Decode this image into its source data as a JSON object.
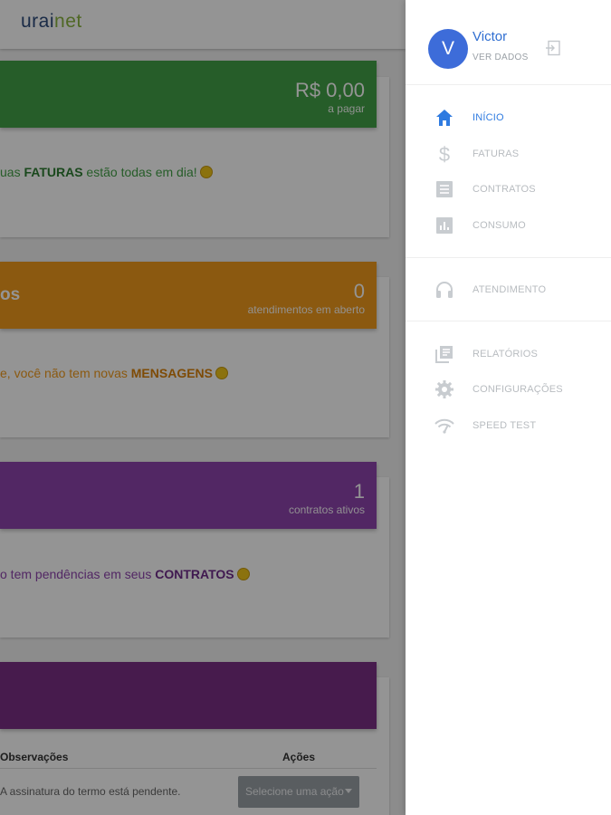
{
  "app": {
    "logo_part1": "urai",
    "logo_part2": "net"
  },
  "colors": {
    "green": "#43a047",
    "orange": "#f09a1c",
    "purple": "#8e44ad",
    "dark_purple": "#7a2f86",
    "accent_blue": "#2f7be0"
  },
  "cards": {
    "faturas": {
      "amount": "R$ 0,00",
      "amount_label": "a pagar",
      "msg_pre": "uas ",
      "msg_bold": "FATURAS",
      "msg_post": " estão todas em dia!"
    },
    "atendimentos": {
      "title": "os",
      "count": "0",
      "count_label": "atendimentos em aberto",
      "msg_pre": "e, você não tem novas ",
      "msg_bold": "MENSAGENS"
    },
    "contratos": {
      "count": "1",
      "count_label": "contratos ativos",
      "msg_pre": "o tem pendências em seus ",
      "msg_bold": "CONTRATOS"
    },
    "termos": {
      "col_obs": "Observações",
      "col_acoes": "Ações",
      "row_obs": "A assinatura do termo está pendente.",
      "select_placeholder": "Selecione uma ação"
    }
  },
  "drawer": {
    "avatar_initial": "V",
    "user_name": "Victor",
    "user_sub": "VER DADOS",
    "items": [
      {
        "label": "INÍCIO",
        "icon": "home-icon"
      },
      {
        "label": "FATURAS",
        "icon": "dollar-icon"
      },
      {
        "label": "CONTRATOS",
        "icon": "document-icon"
      },
      {
        "label": "CONSUMO",
        "icon": "chart-icon"
      },
      {
        "label": "ATENDIMENTO",
        "icon": "headset-icon"
      },
      {
        "label": "RELATÓRIOS",
        "icon": "reports-icon"
      },
      {
        "label": "CONFIGURAÇÕES",
        "icon": "gear-icon"
      },
      {
        "label": "SPEED TEST",
        "icon": "wifi-icon"
      }
    ]
  }
}
